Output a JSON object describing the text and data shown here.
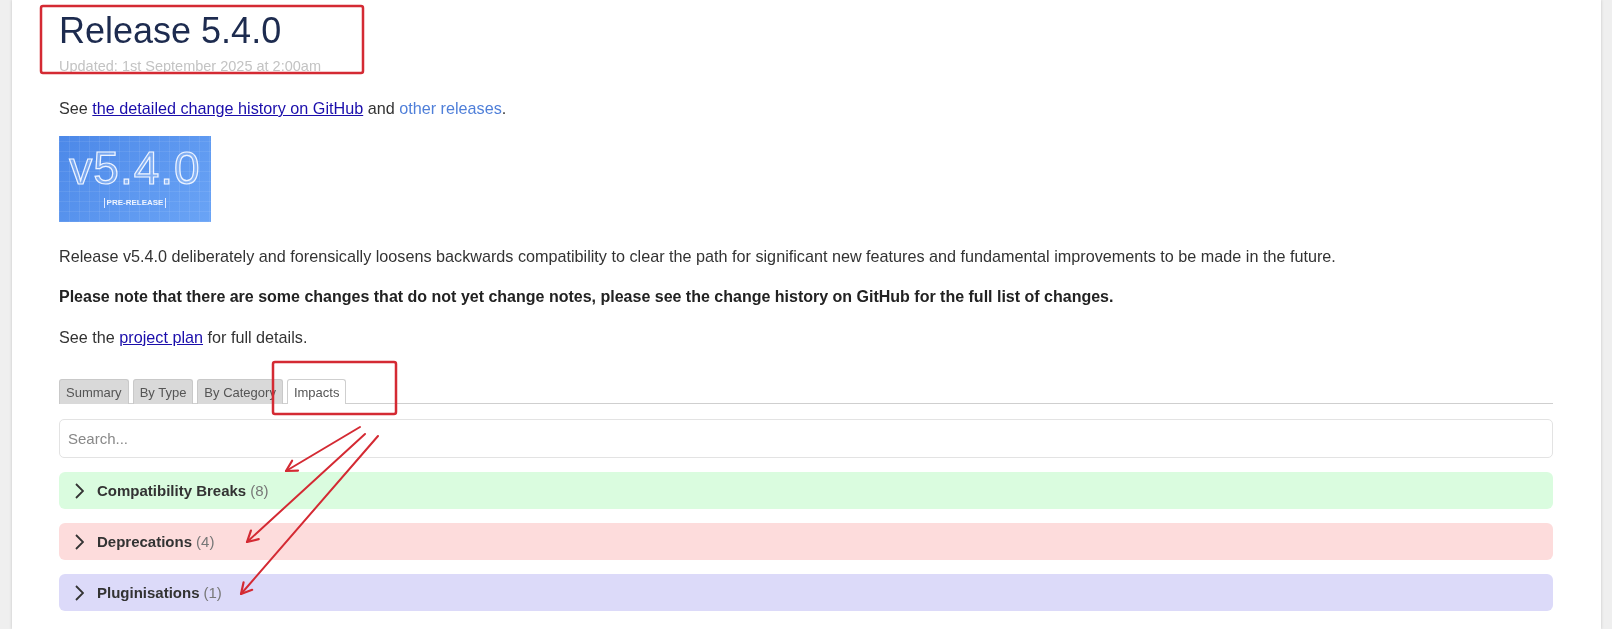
{
  "header": {
    "title": "Release 5.4.0",
    "updated": "Updated: 1st September 2025 at 2:00am"
  },
  "content": [
    {
      "kind": "paragraph",
      "segments": [
        {
          "kind": "text",
          "text": "See "
        },
        {
          "kind": "link",
          "text": "the detailed change history on GitHub"
        },
        {
          "kind": "text",
          "text": " and "
        },
        {
          "kind": "plainlink",
          "text": "other releases"
        },
        {
          "kind": "text",
          "text": "."
        }
      ]
    },
    {
      "kind": "banner",
      "version": "v5.4.0",
      "caption": "PRE-RELEASE"
    },
    {
      "kind": "paragraph",
      "segments": [
        {
          "kind": "text",
          "text": "Release v5.4.0 deliberately and forensically loosens backwards compatibility to clear the path for significant new features and fundamental improvements to be made in the future."
        }
      ]
    },
    {
      "kind": "note",
      "segments": [
        {
          "kind": "text",
          "text": "Please note that there are some changes that do not yet change notes, please see the change history on GitHub for the full list of changes."
        }
      ]
    },
    {
      "kind": "paragraph",
      "segments": [
        {
          "kind": "text",
          "text": "See the "
        },
        {
          "kind": "link",
          "text": "project plan"
        },
        {
          "kind": "text",
          "text": " for full details."
        }
      ]
    }
  ],
  "tabs": [
    {
      "label": "Summary",
      "selected": false
    },
    {
      "label": "By Type",
      "selected": false
    },
    {
      "label": "By Category",
      "selected": false
    },
    {
      "label": "Impacts",
      "selected": true
    }
  ],
  "search": {
    "placeholder": "Search..."
  },
  "groups": [
    {
      "title": "Compatibility Breaks",
      "count": "(8)",
      "color": "#dafcdf",
      "expanded": false
    },
    {
      "title": "Deprecations",
      "count": "(4)",
      "color": "#fddcdc",
      "expanded": false
    },
    {
      "title": "Pluginisations",
      "count": "(1)",
      "color": "#dcdaf9",
      "expanded": false
    }
  ],
  "annotations": [
    {
      "kind": "box"
    },
    {
      "kind": "box"
    },
    {
      "kind": "arrow"
    },
    {
      "kind": "arrow"
    },
    {
      "kind": "arrow"
    }
  ]
}
